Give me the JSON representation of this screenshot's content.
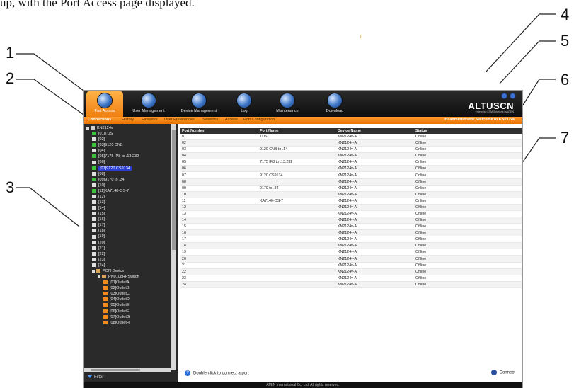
{
  "caption": "up, with the Port Access page displayed.",
  "callouts": [
    "1",
    "2",
    "3",
    "4",
    "5",
    "6",
    "7"
  ],
  "cursor_mark": "ɪ",
  "app": {
    "main_tabs": [
      {
        "label": "Port Access",
        "icon": "port-access-icon",
        "active": true
      },
      {
        "label": "User Management",
        "icon": "user-management-icon",
        "active": false
      },
      {
        "label": "Device Management",
        "icon": "device-management-icon",
        "active": false
      },
      {
        "label": "Log",
        "icon": "log-icon",
        "active": false
      },
      {
        "label": "Maintenance",
        "icon": "maintenance-icon",
        "active": false
      },
      {
        "label": "Download",
        "icon": "download-icon",
        "active": false
      }
    ],
    "logo": "ALTUSCN",
    "logo_sub": "Enterprise KVM Solutions by ATEN",
    "sub_tabs": [
      "Connections",
      "History",
      "Favorites",
      "User Preferences",
      "Sessions",
      "Access",
      "Port Configuration"
    ],
    "active_sub_tab": "Connections",
    "welcome": "Hi administrator, welcome to KN2124v",
    "tree": [
      {
        "label": "KN2124v",
        "level": 0,
        "icon": "kvm"
      },
      {
        "label": "[01]TDS",
        "level": 1,
        "icon": "online"
      },
      {
        "label": "[02]",
        "level": 1,
        "icon": "offline"
      },
      {
        "label": "[03]9120 CNB",
        "level": 1,
        "icon": "online"
      },
      {
        "label": "[04]",
        "level": 1,
        "icon": "offline"
      },
      {
        "label": "[05]7175 IP8 to .13.232",
        "level": 1,
        "icon": "online"
      },
      {
        "label": "[06]",
        "level": 1,
        "icon": "offline"
      },
      {
        "label": "[07]9120 CS9134",
        "level": 1,
        "icon": "online",
        "selected": true
      },
      {
        "label": "[08]",
        "level": 1,
        "icon": "offline"
      },
      {
        "label": "[09]9170 to .34",
        "level": 1,
        "icon": "online"
      },
      {
        "label": "[10]",
        "level": 1,
        "icon": "offline"
      },
      {
        "label": "[11]KA7140-OS-7",
        "level": 1,
        "icon": "online"
      },
      {
        "label": "[12]",
        "level": 1,
        "icon": "offline"
      },
      {
        "label": "[13]",
        "level": 1,
        "icon": "offline"
      },
      {
        "label": "[14]",
        "level": 1,
        "icon": "offline"
      },
      {
        "label": "[15]",
        "level": 1,
        "icon": "offline"
      },
      {
        "label": "[16]",
        "level": 1,
        "icon": "offline"
      },
      {
        "label": "[17]",
        "level": 1,
        "icon": "offline"
      },
      {
        "label": "[18]",
        "level": 1,
        "icon": "offline"
      },
      {
        "label": "[19]",
        "level": 1,
        "icon": "offline"
      },
      {
        "label": "[20]",
        "level": 1,
        "icon": "offline"
      },
      {
        "label": "[21]",
        "level": 1,
        "icon": "offline"
      },
      {
        "label": "[22]",
        "level": 1,
        "icon": "offline"
      },
      {
        "label": "[23]",
        "level": 1,
        "icon": "offline"
      },
      {
        "label": "[24]",
        "level": 1,
        "icon": "offline"
      },
      {
        "label": "PON Device",
        "level": 1,
        "icon": "pdu"
      },
      {
        "label": "PN0108RPSwitch",
        "level": 2,
        "icon": "pdu"
      },
      {
        "label": "[01]OutletA",
        "level": 3,
        "icon": "outlet"
      },
      {
        "label": "[02]OutletB",
        "level": 3,
        "icon": "outlet"
      },
      {
        "label": "[03]OutletC",
        "level": 3,
        "icon": "outlet"
      },
      {
        "label": "[04]OutletD",
        "level": 3,
        "icon": "outlet"
      },
      {
        "label": "[05]OutletE",
        "level": 3,
        "icon": "outlet"
      },
      {
        "label": "[06]OutletF",
        "level": 3,
        "icon": "outlet"
      },
      {
        "label": "[07]OutletG",
        "level": 3,
        "icon": "outlet"
      },
      {
        "label": "[08]OutletH",
        "level": 3,
        "icon": "outlet"
      }
    ],
    "filter_label": "Filter",
    "table": {
      "headers": [
        "Port Number",
        "Port Name",
        "Device Name",
        "Status"
      ],
      "rows": [
        [
          "01",
          "TDS",
          "KN2124v-Al",
          "Online"
        ],
        [
          "02",
          "",
          "KN2124v-Al",
          "Offline"
        ],
        [
          "03",
          "9120 CNB to .14",
          "KN2124v-Al",
          "Online"
        ],
        [
          "04",
          "",
          "KN2124v-Al",
          "Offline"
        ],
        [
          "05",
          "7175 IP8 to .13.232",
          "KN2124v-Al",
          "Online"
        ],
        [
          "06",
          "",
          "KN2124v-Al",
          "Offline"
        ],
        [
          "07",
          "9120 CS9134",
          "KN2124v-Al",
          "Online"
        ],
        [
          "08",
          "",
          "KN2124v-Al",
          "Offline"
        ],
        [
          "09",
          "9170 to .34",
          "KN2124v-Al",
          "Online"
        ],
        [
          "10",
          "",
          "KN2124v-Al",
          "Offline"
        ],
        [
          "11",
          "KA7140-OS-7",
          "KN2124v-Al",
          "Online"
        ],
        [
          "12",
          "",
          "KN2124v-Al",
          "Offline"
        ],
        [
          "13",
          "",
          "KN2124v-Al",
          "Offline"
        ],
        [
          "14",
          "",
          "KN2124v-Al",
          "Offline"
        ],
        [
          "15",
          "",
          "KN2124v-Al",
          "Offline"
        ],
        [
          "16",
          "",
          "KN2124v-Al",
          "Offline"
        ],
        [
          "17",
          "",
          "KN2124v-Al",
          "Offline"
        ],
        [
          "18",
          "",
          "KN2124v-Al",
          "Offline"
        ],
        [
          "19",
          "",
          "KN2124v-Al",
          "Offline"
        ],
        [
          "20",
          "",
          "KN2124v-Al",
          "Offline"
        ],
        [
          "21",
          "",
          "KN2124v-Al",
          "Offline"
        ],
        [
          "22",
          "",
          "KN2124v-Al",
          "Offline"
        ],
        [
          "23",
          "",
          "KN2124v-Al",
          "Offline"
        ],
        [
          "24",
          "",
          "KN2124v-Al",
          "Offline"
        ]
      ]
    },
    "hint": "Double click to connect a port",
    "connect_label": "Connect",
    "footer": "ATEN International Co. Ltd. All rights reserved."
  }
}
